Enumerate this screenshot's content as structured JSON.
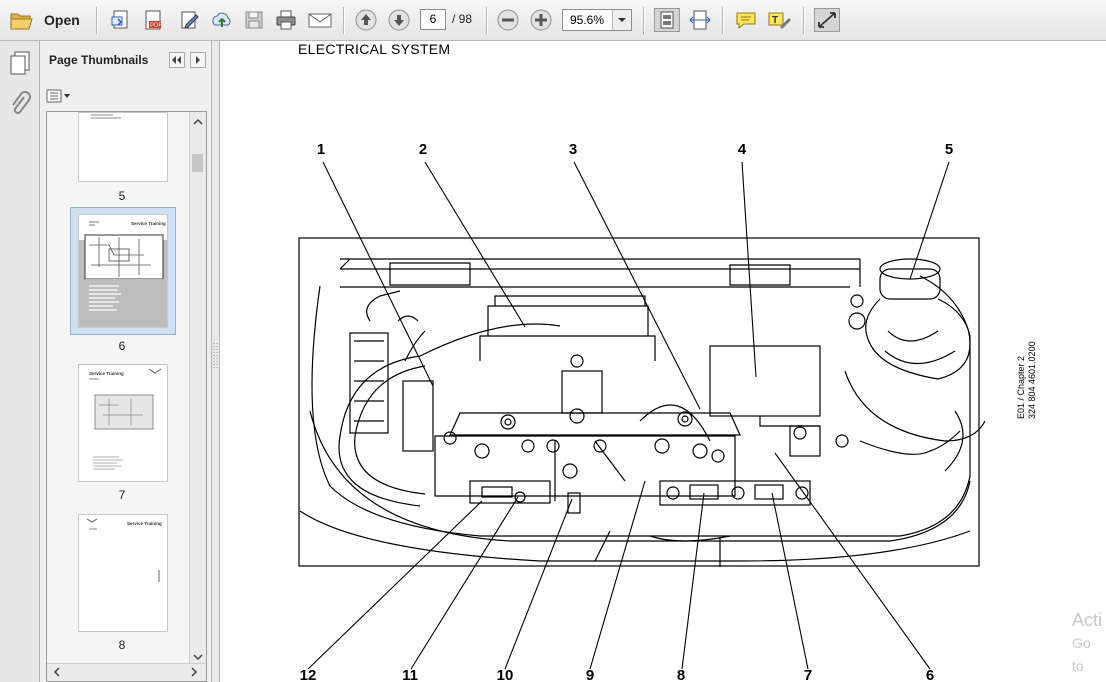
{
  "toolbar": {
    "open_label": "Open",
    "current_page": "6",
    "page_total": "/ 98",
    "zoom_value": "95.6%"
  },
  "sidebar": {
    "title": "Page Thumbnails",
    "thumbnails": [
      {
        "label": "5"
      },
      {
        "label": "6",
        "selected": true,
        "header": "Service Training"
      },
      {
        "label": "7",
        "header": "Service Training"
      },
      {
        "label": "8",
        "header": "Service Training"
      }
    ]
  },
  "document": {
    "heading": "ELECTRICAL  SYSTEM",
    "side_line1": "E01 / Chapter 2",
    "side_line2": "324 804 4601.0200",
    "callouts": [
      "1",
      "2",
      "3",
      "4",
      "5",
      "6",
      "7",
      "8",
      "9",
      "10",
      "11",
      "12"
    ]
  },
  "overlay": {
    "watermark_line1": "Acti",
    "watermark_line2": "Go to"
  },
  "colors": {
    "toolbar_bg": "#e9e9e9",
    "selected_thumb": "#cfe0f2",
    "line": "#000000"
  }
}
